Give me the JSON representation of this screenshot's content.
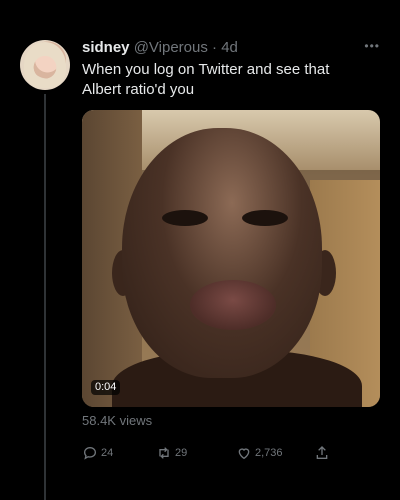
{
  "tweet": {
    "display_name": "sidney",
    "handle": "@Viperous",
    "separator": "·",
    "time": "4d",
    "text_line1": "When you log on Twitter and see that",
    "text_line2": "Albert ratio'd you",
    "media": {
      "duration": "0:04"
    },
    "views": "58.4K views",
    "actions": {
      "replies": "24",
      "retweets": "29",
      "likes": "2,736"
    }
  },
  "icons": [
    "more-icon",
    "reply-icon",
    "retweet-icon",
    "like-icon",
    "share-icon"
  ],
  "colors": {
    "background": "#000000",
    "text": "#e7e9ea",
    "muted": "#71767b"
  }
}
